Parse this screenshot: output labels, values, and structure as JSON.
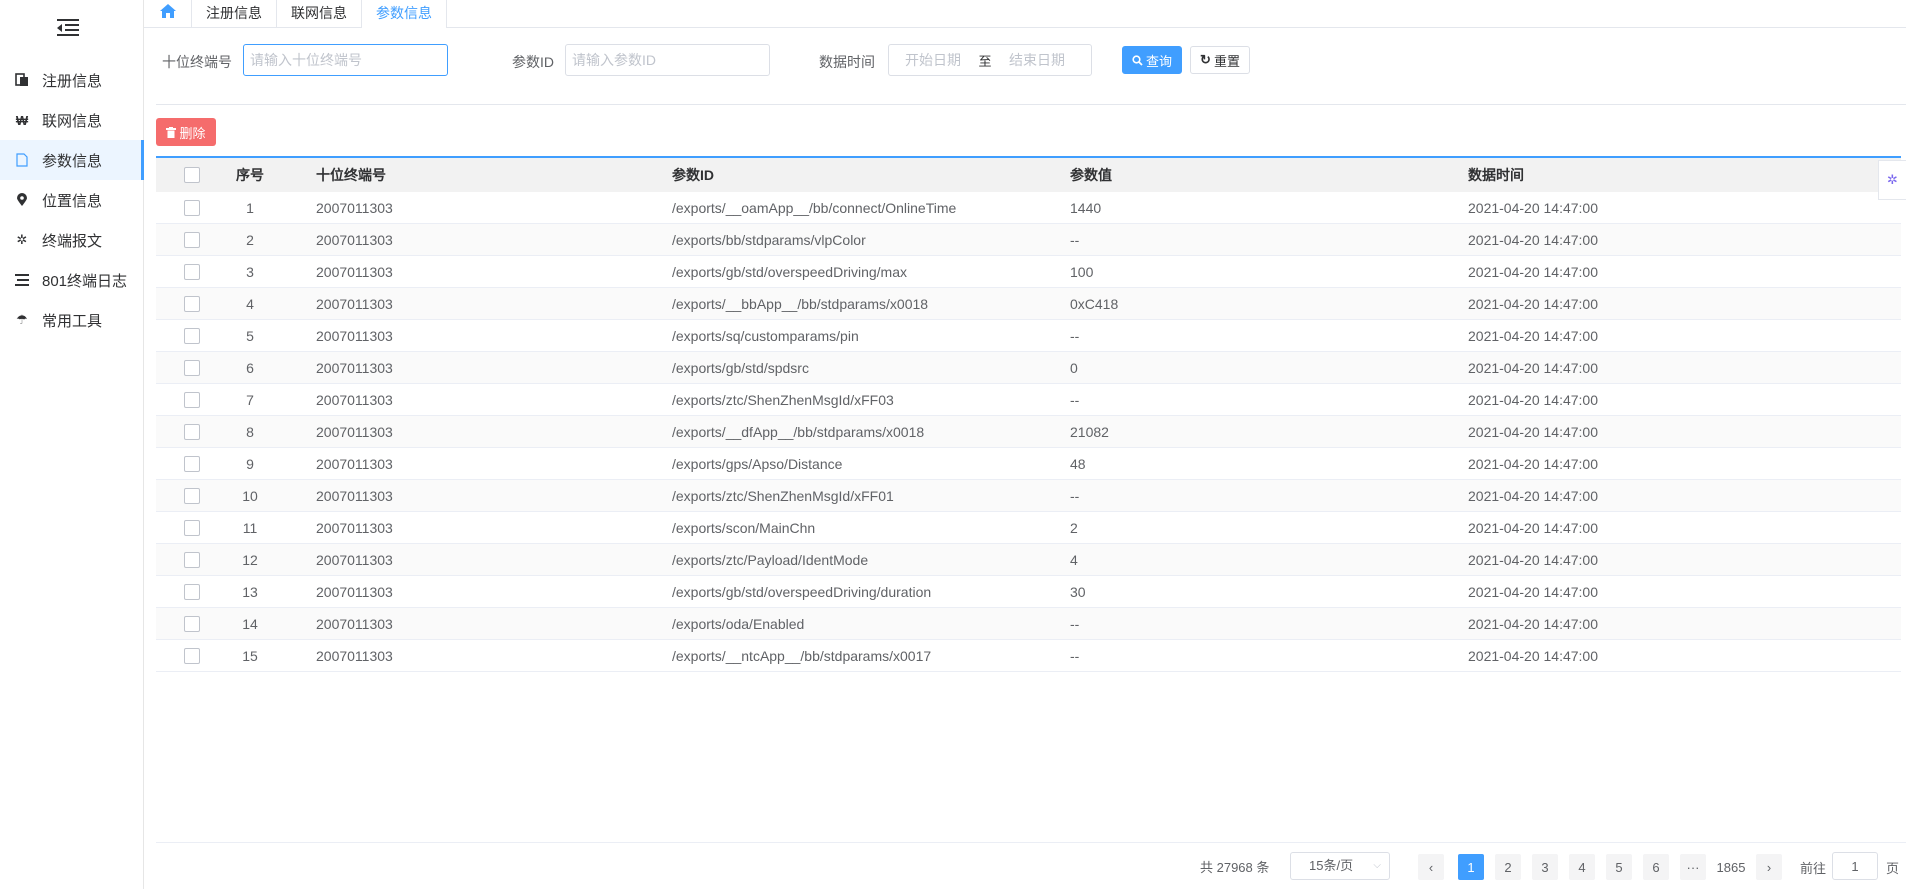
{
  "sidebar": {
    "items": [
      {
        "label": "注册信息",
        "icon": "clipboard-icon"
      },
      {
        "label": "联网信息",
        "icon": "won-icon"
      },
      {
        "label": "参数信息",
        "icon": "document-icon",
        "active": true
      },
      {
        "label": "位置信息",
        "icon": "map-pin-icon"
      },
      {
        "label": "终端报文",
        "icon": "gear-icon"
      },
      {
        "label": "801终端日志",
        "icon": "list-icon"
      },
      {
        "label": "常用工具",
        "icon": "umbrella-icon"
      }
    ]
  },
  "tabs": [
    {
      "label": "注册信息"
    },
    {
      "label": "联网信息"
    },
    {
      "label": "参数信息",
      "active": true
    }
  ],
  "search": {
    "terminal_label": "十位终端号",
    "terminal_placeholder": "请输入十位终端号",
    "param_label": "参数ID",
    "param_placeholder": "请输入参数ID",
    "time_label": "数据时间",
    "start_placeholder": "开始日期",
    "range_sep": "至",
    "end_placeholder": "结束日期",
    "query_label": "查询",
    "reset_label": "重置"
  },
  "toolbar": {
    "delete_label": "删除"
  },
  "table": {
    "headers": {
      "no": "序号",
      "terminal": "十位终端号",
      "param_id": "参数ID",
      "value": "参数值",
      "time": "数据时间"
    },
    "rows": [
      {
        "no": "1",
        "terminal": "2007011303",
        "param_id": "/exports/__oamApp__/bb/connect/OnlineTime",
        "value": "1440",
        "time": "2021-04-20 14:47:00"
      },
      {
        "no": "2",
        "terminal": "2007011303",
        "param_id": "/exports/bb/stdparams/vlpColor",
        "value": "--",
        "time": "2021-04-20 14:47:00"
      },
      {
        "no": "3",
        "terminal": "2007011303",
        "param_id": "/exports/gb/std/overspeedDriving/max",
        "value": "100",
        "time": "2021-04-20 14:47:00"
      },
      {
        "no": "4",
        "terminal": "2007011303",
        "param_id": "/exports/__bbApp__/bb/stdparams/x0018",
        "value": "0xC418",
        "time": "2021-04-20 14:47:00"
      },
      {
        "no": "5",
        "terminal": "2007011303",
        "param_id": "/exports/sq/customparams/pin",
        "value": "--",
        "time": "2021-04-20 14:47:00"
      },
      {
        "no": "6",
        "terminal": "2007011303",
        "param_id": "/exports/gb/std/spdsrc",
        "value": "0",
        "time": "2021-04-20 14:47:00"
      },
      {
        "no": "7",
        "terminal": "2007011303",
        "param_id": "/exports/ztc/ShenZhenMsgId/xFF03",
        "value": "--",
        "time": "2021-04-20 14:47:00"
      },
      {
        "no": "8",
        "terminal": "2007011303",
        "param_id": "/exports/__dfApp__/bb/stdparams/x0018",
        "value": "21082",
        "time": "2021-04-20 14:47:00"
      },
      {
        "no": "9",
        "terminal": "2007011303",
        "param_id": "/exports/gps/Apso/Distance",
        "value": "48",
        "time": "2021-04-20 14:47:00"
      },
      {
        "no": "10",
        "terminal": "2007011303",
        "param_id": "/exports/ztc/ShenZhenMsgId/xFF01",
        "value": "--",
        "time": "2021-04-20 14:47:00"
      },
      {
        "no": "11",
        "terminal": "2007011303",
        "param_id": "/exports/scon/MainChn",
        "value": "2",
        "time": "2021-04-20 14:47:00"
      },
      {
        "no": "12",
        "terminal": "2007011303",
        "param_id": "/exports/ztc/Payload/IdentMode",
        "value": "4",
        "time": "2021-04-20 14:47:00"
      },
      {
        "no": "13",
        "terminal": "2007011303",
        "param_id": "/exports/gb/std/overspeedDriving/duration",
        "value": "30",
        "time": "2021-04-20 14:47:00"
      },
      {
        "no": "14",
        "terminal": "2007011303",
        "param_id": "/exports/oda/Enabled",
        "value": "--",
        "time": "2021-04-20 14:47:00"
      },
      {
        "no": "15",
        "terminal": "2007011303",
        "param_id": "/exports/__ntcApp__/bb/stdparams/x0017",
        "value": "--",
        "time": "2021-04-20 14:47:00"
      }
    ]
  },
  "pagination": {
    "total_text": "共 27968 条",
    "page_size": "15条/页",
    "pages": [
      "1",
      "2",
      "3",
      "4",
      "5",
      "6"
    ],
    "more": "···",
    "last_page": "1865",
    "current": "1",
    "goto_prefix": "前往",
    "goto_value": "1",
    "goto_suffix": "页"
  },
  "colors": {
    "accent": "#409eff",
    "danger": "#f56c6c"
  }
}
